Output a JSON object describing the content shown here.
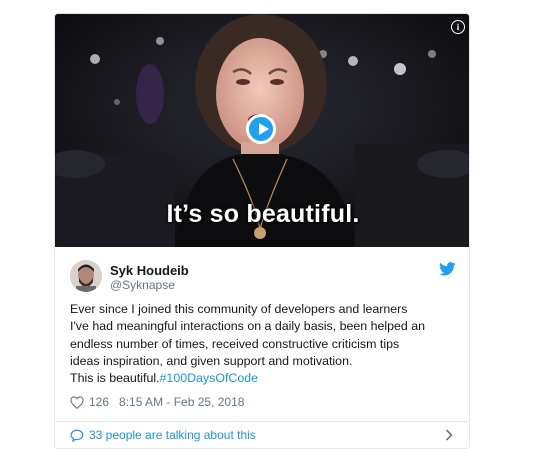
{
  "media": {
    "caption": "It’s so beautiful.",
    "info_icon": "i",
    "play_icon": "play-icon"
  },
  "tweet": {
    "author_name": "Syk Houdeib",
    "handle": "@Syknapse",
    "text_lines": [
      "Ever since I joined this community of developers and learners",
      "I've had meaningful interactions on a daily basis, been helped an",
      "endless number of times, received constructive criticism tips",
      "ideas inspiration, and given support and motivation."
    ],
    "last_line_prefix": "This is beautiful.",
    "hashtag": "#100DaysOfCode",
    "likes": "126",
    "timestamp": "8:15 AM - Feb 25, 2018",
    "conversation": "33 people are talking about this"
  },
  "colors": {
    "accent": "#1da1f2",
    "link": "#1b95e0",
    "muted": "#657786"
  },
  "icons": [
    "info-icon",
    "play-icon",
    "twitter-bird-icon",
    "heart-icon",
    "speech-bubble-icon",
    "chevron-right-icon"
  ]
}
